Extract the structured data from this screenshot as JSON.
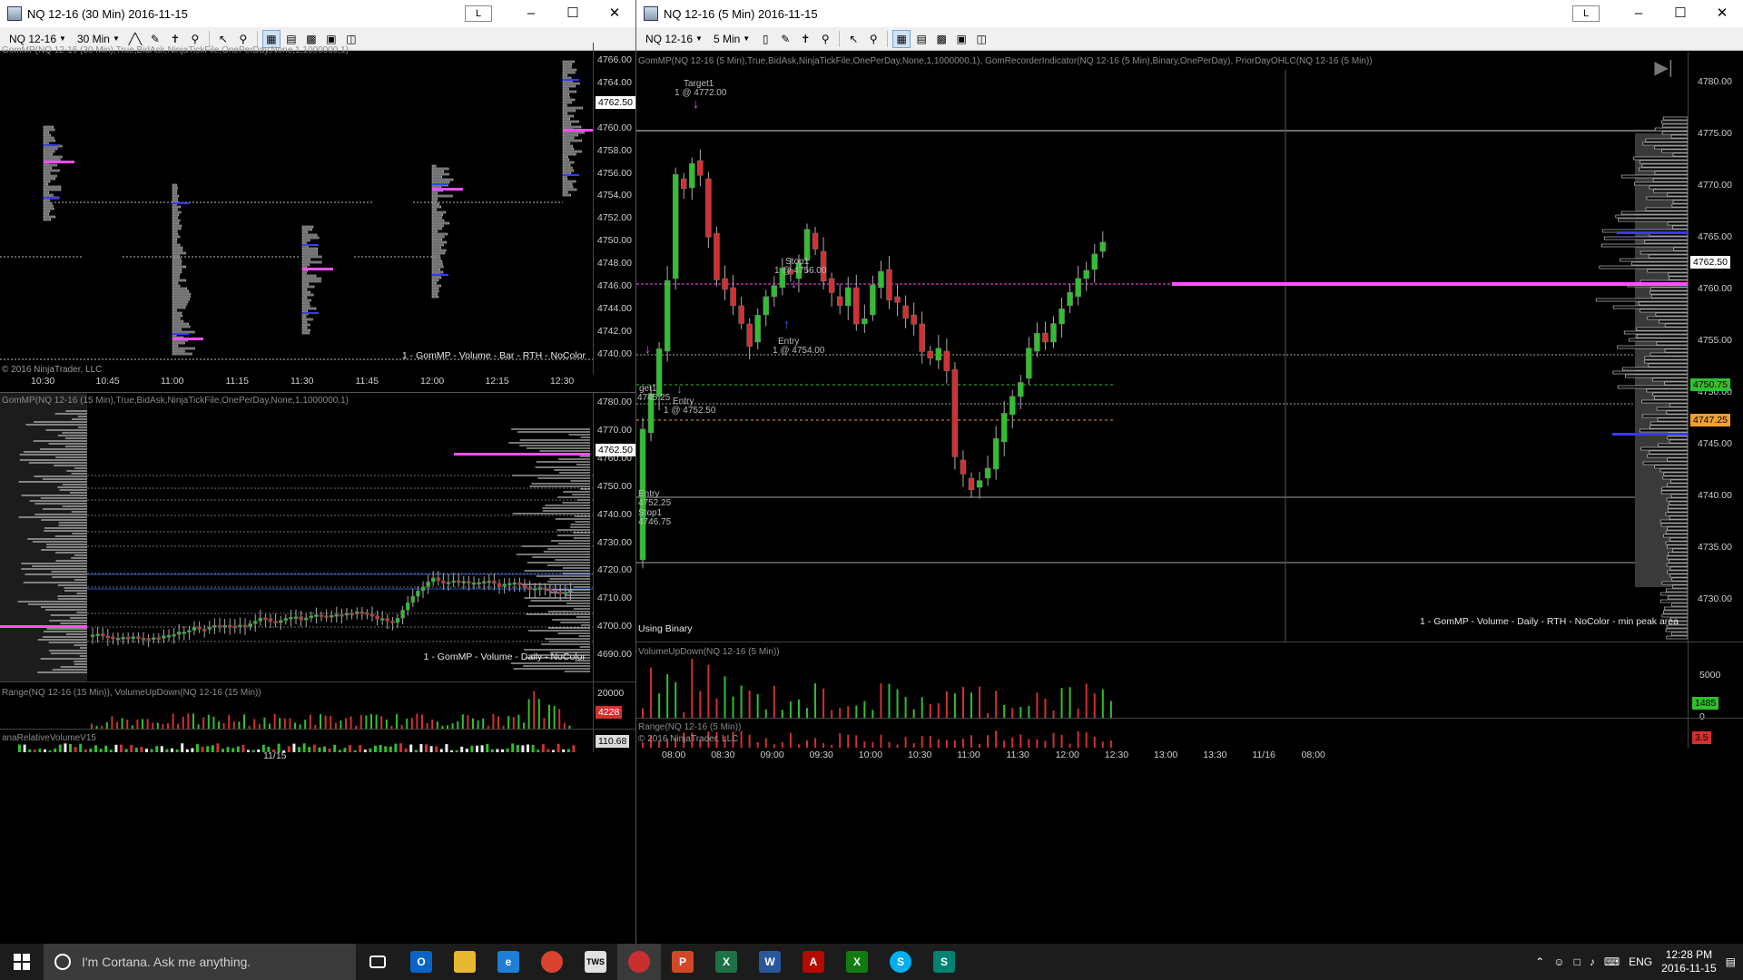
{
  "windows": {
    "w30": {
      "title": "NQ 12-16 (30 Min)  2016-11-15",
      "instrument": "NQ 12-16",
      "interval": "30 Min",
      "lbtn": "L",
      "indicator_label": "GomMP(NQ 12-16 (30 Min),True,BidAsk,NinjaTickFile,OnePerDay,None,1,1000000,1)",
      "watermark": "1 - GomMP  - Volume - Bar - RTH - NoColor",
      "copyright": "© 2016 NinjaTrader, LLC",
      "price_axis": [
        "4766.00",
        "4764.00",
        "4762.00",
        "4760.00",
        "4758.00",
        "4756.00",
        "4754.00",
        "4752.00",
        "4750.00",
        "4748.00",
        "4746.00",
        "4744.00",
        "4742.00",
        "4740.00"
      ],
      "last_price": "4762.50",
      "time_axis": [
        "10:30",
        "10:45",
        "11:00",
        "11:15",
        "11:30",
        "11:45",
        "12:00",
        "12:15",
        "12:30"
      ]
    },
    "w15": {
      "indicator_label": "GomMP(NQ 12-16 (15 Min),True,BidAsk,NinjaTickFile,OnePerDay,None,1,1000000,1)",
      "watermark": "1 - GomMP  - Volume - Daily - NoColor",
      "price_axis": [
        "4780.00",
        "4770.00",
        "4760.00",
        "4750.00",
        "4740.00",
        "4730.00",
        "4720.00",
        "4710.00",
        "4700.00",
        "4690.00"
      ],
      "last_price": "4762.50",
      "panel2_label": "Range(NQ 12-16 (15 Min)), VolumeUpDown(NQ 12-16 (15 Min))",
      "panel2_axis": "20000",
      "panel2_value": "4228",
      "panel3_label": "anaRelativeVolumeV15",
      "panel3_value": "110.68",
      "time_axis": [
        "11/15"
      ]
    },
    "w5": {
      "title": "NQ 12-16 (5 Min)  2016-11-15",
      "instrument": "NQ 12-16",
      "interval": "5 Min",
      "lbtn": "L",
      "indicator_label": "GomMP(NQ 12-16 (5 Min),True,BidAsk,NinjaTickFile,OnePerDay,None,1,1000000,1), GomRecorderIndicator(NQ 12-16 (5 Min),Binary,OnePerDay), PriorDayOHLC(NQ 12-16 (5 Min))",
      "watermark": "1 - GomMP  - Volume - Daily - RTH - NoColor - min peak area",
      "using": "Using Binary",
      "price_axis": [
        "4780.00",
        "4775.00",
        "4770.00",
        "4765.00",
        "4760.00",
        "4755.00",
        "4750.00",
        "4745.00",
        "4740.00",
        "4735.00",
        "4730.00"
      ],
      "last_price": "4762.50",
      "price_box_green": "4750.75",
      "price_box_orange": "4747.25",
      "vol_label": "VolumeUpDown(NQ 12-16 (5 Min))",
      "vol_axis": [
        "5000",
        "0"
      ],
      "vol_value": "1485",
      "range_label": "Range(NQ 12-16 (5 Min))",
      "range_value": "3.5",
      "copyright": "© 2016 NinjaTrader, LLC",
      "time_axis": [
        "08:00",
        "08:30",
        "09:00",
        "09:30",
        "10:00",
        "10:30",
        "11:00",
        "11:30",
        "12:00",
        "12:30",
        "13:00",
        "13:30",
        "11/16",
        "08:00"
      ],
      "annotations": {
        "target_top": "Target1",
        "target_top_val": "1 @ 4772.00",
        "stop_mid": "Stop1",
        "stop_mid_val": "1 @ 4756.00",
        "entry_mid": "Entry",
        "entry_mid_val": "1 @ 4754.00",
        "target_left": "get1",
        "target_left_val": "4745.25",
        "entry_left": "Entry",
        "entry_left_val": "1 @ 4752.50",
        "entry_bottom": "Entry",
        "entry_bottom_val": "4752.25",
        "stop_bottom": "Stop1",
        "stop_bottom_val": "4746.75"
      }
    }
  },
  "taskbar": {
    "cortana_placeholder": "I'm Cortana. Ask me anything.",
    "language": "ENG",
    "time": "12:28 PM",
    "date": "2016-11-15"
  },
  "colors": {
    "up": "#2fbf2f",
    "down": "#d23030",
    "poc": "#ff4dff",
    "value_area": "#3a3aff"
  }
}
